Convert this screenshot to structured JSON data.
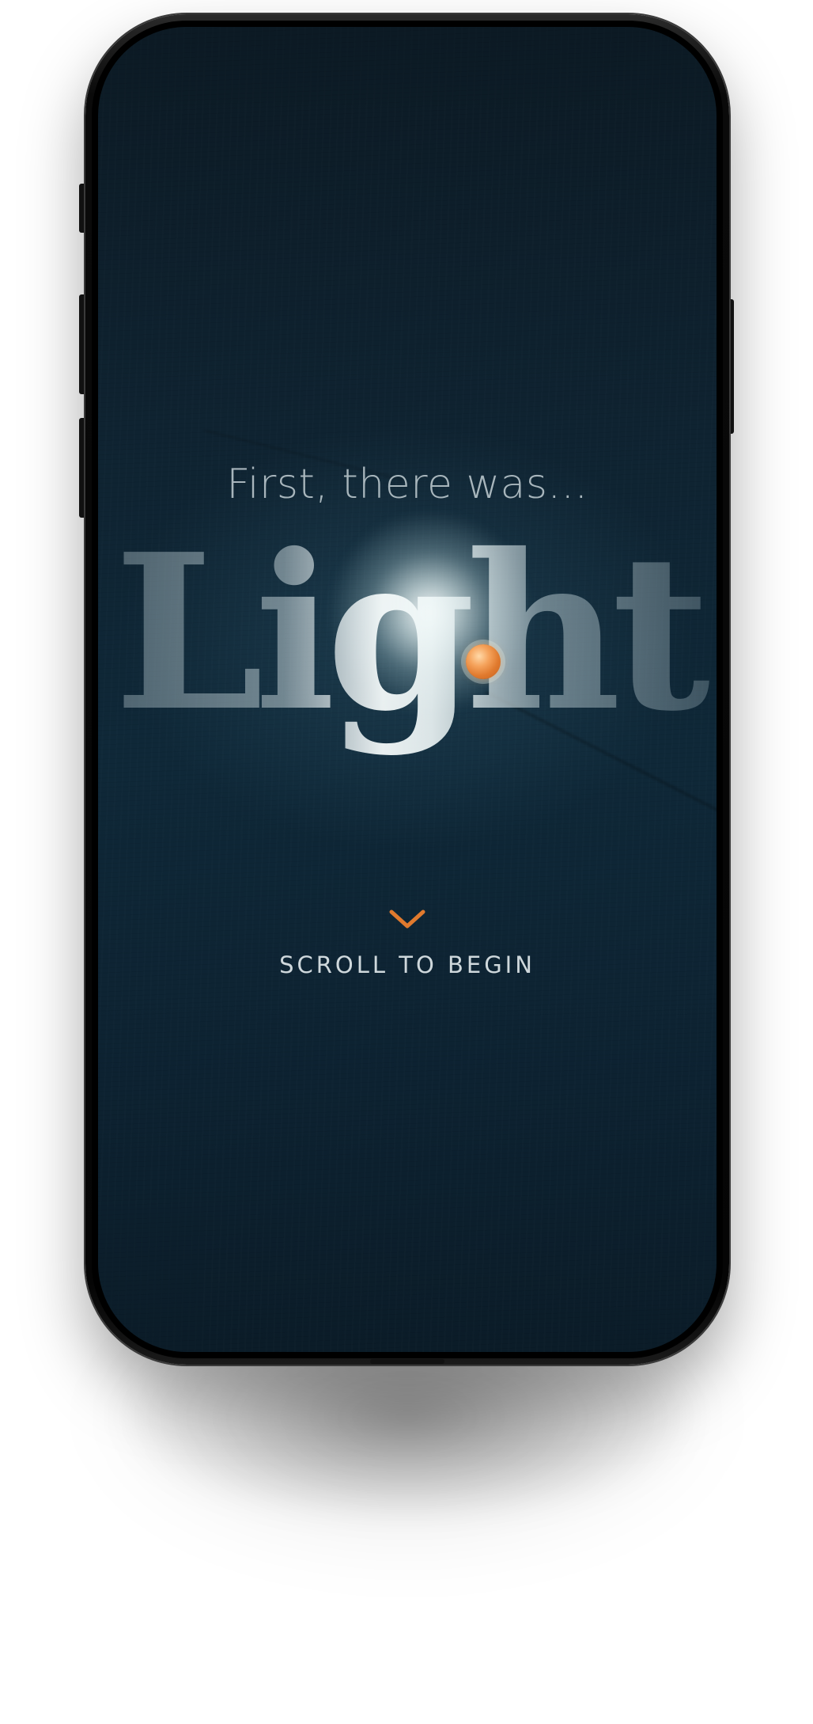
{
  "intro": {
    "eyebrow": "First, there was...",
    "hero_word": "Light"
  },
  "cta": {
    "label": "SCROLL TO BEGIN",
    "icon": "chevron-down-icon"
  },
  "colors": {
    "background": "#0f2433",
    "accent": "#e07a2e",
    "text": "#cfd8dc"
  }
}
